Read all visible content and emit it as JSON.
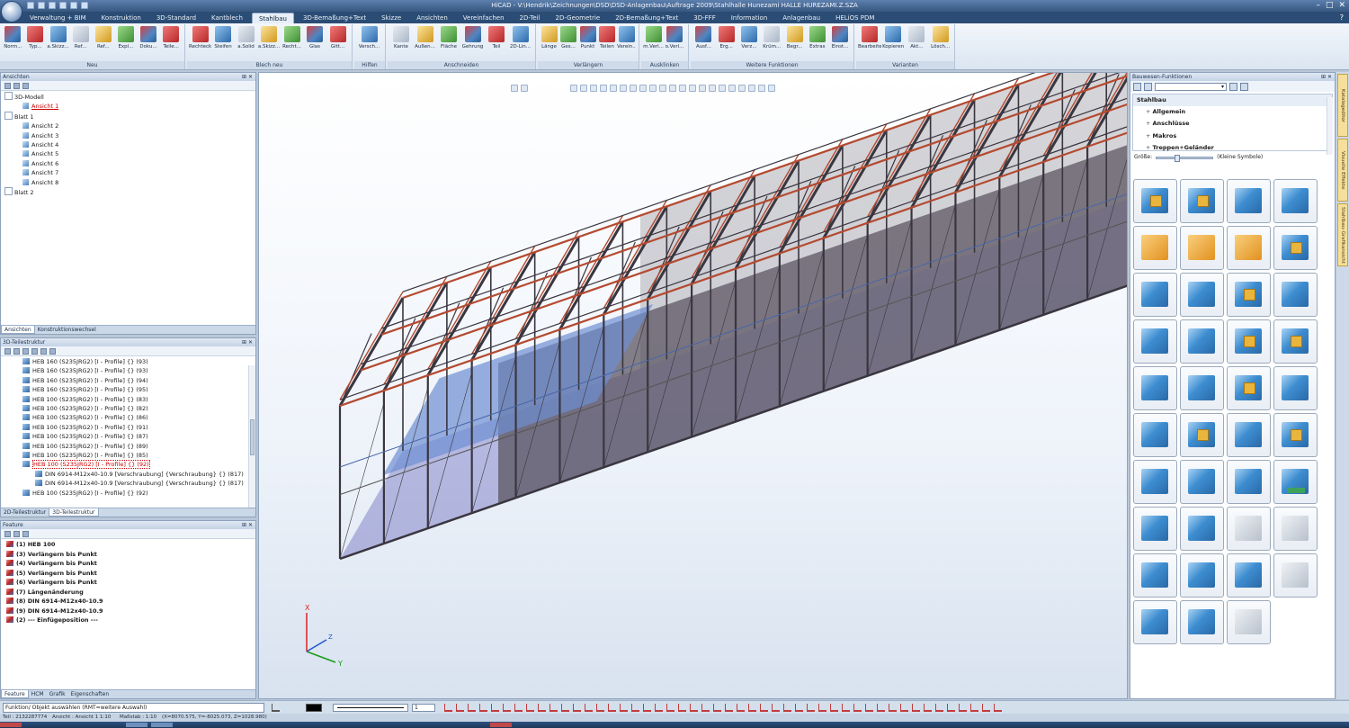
{
  "window": {
    "title": "HiCAD - V:\\Hendrik\\Zeichnungen\\DSD\\DSD-Anlagenbau\\Auftrage 2009\\Stahlhalle Hunezami HALLE HUREZAMI.Z.SZA",
    "minimize": "–",
    "maximize": "□",
    "close": "✕"
  },
  "menu_tabs": [
    "Verwaltung + BIM",
    "Konstruktion",
    "3D-Standard",
    "Kantblech",
    "Stahlbau",
    "3D-Bemaßung+Text",
    "Skizze",
    "Ansichten",
    "Vereinfachen",
    "2D-Teil",
    "2D-Geometrie",
    "2D-Bemaßung+Text",
    "3D-FFF",
    "Information",
    "Anlagenbau",
    "HELiOS PDM"
  ],
  "active_tab": "Stahlbau",
  "ribbon": {
    "groups": [
      {
        "label": "Neu",
        "buttons": [
          "Norm...",
          "Typ...",
          "a.Skizz...",
          "Ref...",
          "Ref...",
          "Expl...",
          "Doku...",
          "Teile..."
        ]
      },
      {
        "label": "Blech neu",
        "buttons": [
          "Rechteck",
          "Steifen",
          "a.Solid",
          "a.Skizz...",
          "Recht...",
          "Glas",
          "Gitt..."
        ]
      },
      {
        "label": "Hilfen",
        "buttons": [
          "Versch..."
        ]
      },
      {
        "label": "Anschneiden",
        "buttons": [
          "Kante",
          "Außen...",
          "Fläche",
          "Gehrung",
          "Teil",
          "2D-Lin..."
        ]
      },
      {
        "label": "Verlängern",
        "buttons": [
          "Länge",
          "Ges...",
          "Punkt",
          "Teilen",
          "Verein..."
        ]
      },
      {
        "label": "Ausklinken",
        "buttons": [
          "m.Verl...",
          "o.Verl..."
        ]
      },
      {
        "label": "Weitere Funktionen",
        "buttons": [
          "Ausf...",
          "Erg...",
          "Verz...",
          "Krüm...",
          "Begr...",
          "Extras",
          "Einst..."
        ]
      },
      {
        "label": "Varianten",
        "buttons": [
          "Bearbeiten",
          "Kopieren",
          "Akt...",
          "Lösch..."
        ]
      }
    ]
  },
  "ansichten_panel": {
    "title": "Ansichten",
    "tree": [
      {
        "label": "3D-Modell",
        "level": 0
      },
      {
        "label": "Ansicht 1",
        "level": 1,
        "selected": true
      },
      {
        "label": "Blatt 1",
        "level": 0
      },
      {
        "label": "Ansicht 2",
        "level": 1
      },
      {
        "label": "Ansicht 3",
        "level": 1
      },
      {
        "label": "Ansicht 4",
        "level": 1
      },
      {
        "label": "Ansicht 5",
        "level": 1
      },
      {
        "label": "Ansicht 6",
        "level": 1
      },
      {
        "label": "Ansicht 7",
        "level": 1
      },
      {
        "label": "Ansicht 8",
        "level": 1
      },
      {
        "label": "Blatt 2",
        "level": 0
      }
    ],
    "tabs": [
      "Ansichten",
      "Konstruktionswechsel"
    ]
  },
  "teilestruktur_panel": {
    "title": "3D-Teilestruktur",
    "items": [
      "HEB 160 (S235JRG2) [I - Profile] {} (93)",
      "HEB 160 (S235JRG2) [I - Profile] {} (93)",
      "HEB 160 (S235JRG2) [I - Profile] {} (94)",
      "HEB 160 (S235JRG2) [I - Profile] {} (95)",
      "HEB 100 (S235JRG2) [I - Profile] {} (83)",
      "HEB 100 (S235JRG2) [I - Profile] {} (82)",
      "HEB 100 (S235JRG2) [I - Profile] {} (86)",
      "HEB 100 (S235JRG2) [I - Profile] {} (91)",
      "HEB 100 (S235JRG2) [I - Profile] {} (87)",
      "HEB 100 (S235JRG2) [I - Profile] {} (89)",
      "HEB 100 (S235JRG2) [I - Profile] {} (85)",
      "HEB 100 (S235JRG2) [I - Profile] {} (92)",
      "DIN 6914-M12x40-10.9 [Verschraubung] {Verschraubung} {} (817)",
      "DIN 6914-M12x40-10.9 [Verschraubung] {Verschraubung} {} (817)",
      "HEB 100 (S235JRG2) [I - Profile] {} (92)"
    ],
    "selected_index": 11,
    "tabs": [
      "2D-Teilestruktur",
      "3D-Teilestruktur"
    ]
  },
  "feature_panel": {
    "title": "Feature",
    "items": [
      "(1) HEB 100",
      "(3) Verlängern bis Punkt",
      "(4) Verlängern bis Punkt",
      "(5) Verlängern bis Punkt",
      "(6) Verlängern bis Punkt",
      "(7) Längenänderung",
      "(8) DIN 6914-M12x40-10.9",
      "(9) DIN 6914-M12x40-10.9",
      "(2) --- Einfügeposition ---"
    ],
    "tabs": [
      "Feature",
      "HCM",
      "Grafik",
      "Eigenschaften"
    ]
  },
  "viewport": {
    "axis_x": "X",
    "axis_y": "Y",
    "axis_z": "Z",
    "colors": {
      "frame": "#3a3640",
      "rails": "#b44a30",
      "walls": "#5c5662",
      "platform": "#6d8ed1",
      "floor": "#4a4ab0"
    }
  },
  "bauwesen_panel": {
    "title": "Bauwesen-Funktionen",
    "tree": {
      "header": "Stahlbau",
      "items": [
        "Allgemein",
        "Anschlüsse",
        "Makros",
        "Treppen+Geländer"
      ]
    },
    "size_label": "Größe:",
    "size_value": "(Kleine Symbole)",
    "size_level": 0.35
  },
  "side_tabs": [
    "Katalogeditor",
    "Visuelle Effekte",
    "Stahlbau-Grafikansicht"
  ],
  "command_line": {
    "prompt": "Funktion/ Objekt auswählen (RMT=weitere Auswahl)",
    "line_width": "1"
  },
  "status": {
    "part": "Teil : 2132287774",
    "view": "Ansicht : Ansicht 1 1:10",
    "scale": "Maßstab : 1:10",
    "coords": "(X=8070.575, Y=-8025.073, Z=1028.980)"
  }
}
